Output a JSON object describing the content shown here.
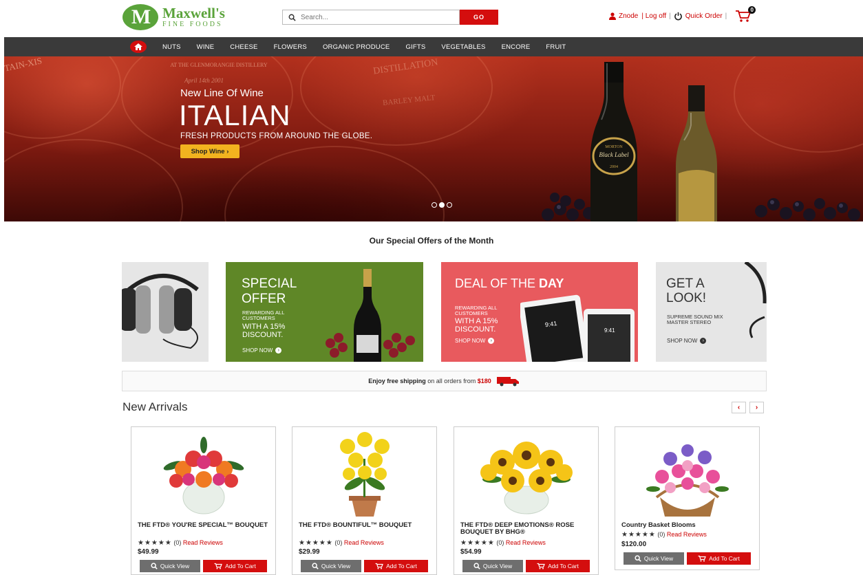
{
  "header": {
    "logo_letter": "M",
    "logo_name": "Maxwell's",
    "logo_sub": "FINE FOODS",
    "search_placeholder": "Search...",
    "search_button": "GO",
    "user_name": "Znode",
    "logoff_label": "| Log off",
    "quick_order_label": "Quick Order",
    "cart_count": "0"
  },
  "nav": {
    "items": [
      "NUTS",
      "WINE",
      "CHEESE",
      "FLOWERS",
      "ORGANIC PRODUCE",
      "GIFTS",
      "VEGETABLES",
      "ENCORE",
      "FRUIT"
    ]
  },
  "hero": {
    "eyebrow": "New Line Of Wine",
    "title": "ITALIAN",
    "tagline": "FRESH PRODUCTS FROM AROUND THE GLOBE.",
    "button": "Shop Wine ›",
    "barrel_text_1": "AT THE GLENMORANGIE DISTILLERY",
    "barrel_text_2": "April 14th 2001",
    "barrel_text_3": "TAIN-XIS",
    "barrel_text_4": "DISTILLATION",
    "barrel_text_5": "BARLEY MALT",
    "label_1": "MORTON",
    "label_2": "Black Label",
    "label_3": "2004",
    "active_slide": 2,
    "slide_count": 3
  },
  "offers": {
    "title": "Our Special Offers of the Month",
    "special": {
      "line1": "SPECIAL",
      "line2": "OFFER",
      "small": "REWARDING ALL\nCUSTOMERS",
      "mid": "WITH A 15%\nDISCOUNT.",
      "shop": "SHOP NOW"
    },
    "deal": {
      "line1": "DEAL OF THE",
      "line1b": "DAY",
      "small": "REWARDING ALL\nCUSTOMERS",
      "mid": "WITH A 15%\nDISCOUNT.",
      "shop": "SHOP NOW",
      "time": "9:41"
    },
    "look": {
      "line1": "GET A",
      "line2": "LOOK!",
      "small": "SUPREME SOUND MIX\nMASTER STEREO",
      "shop": "SHOP NOW"
    }
  },
  "shipping": {
    "bold": "Enjoy free shipping",
    "rest": " on all orders from ",
    "amount": "$180"
  },
  "new_arrivals": {
    "title": "New Arrivals",
    "prev": "‹",
    "next": "›",
    "quick_view": "Quick View",
    "add_to_cart": "Add To Cart",
    "stars": "★★★★★",
    "products": [
      {
        "name": "THE FTD® YOU'RE SPECIAL™ BOUQUET",
        "reviews": "(0)",
        "review_link": "Read Reviews",
        "price": "$49.99"
      },
      {
        "name": "THE FTD® BOUNTIFUL™ BOUQUET",
        "reviews": "(0)",
        "review_link": "Read Reviews",
        "price": "$29.99"
      },
      {
        "name": "THE FTD® DEEP EMOTIONS® ROSE BOUQUET BY BHG®",
        "reviews": "(0)",
        "review_link": "Read Reviews",
        "price": "$54.99"
      },
      {
        "name": "Country Basket Blooms",
        "reviews": "(0)",
        "review_link": "Read Reviews",
        "price": "$120.00"
      }
    ]
  },
  "colors": {
    "brand_green": "#5aa33a",
    "accent_red": "#d40e0e",
    "nav_bg": "#3a3a3a",
    "hero_button": "#f2b31f",
    "special_green": "#5f8727",
    "deal_pink": "#e85a5e"
  }
}
